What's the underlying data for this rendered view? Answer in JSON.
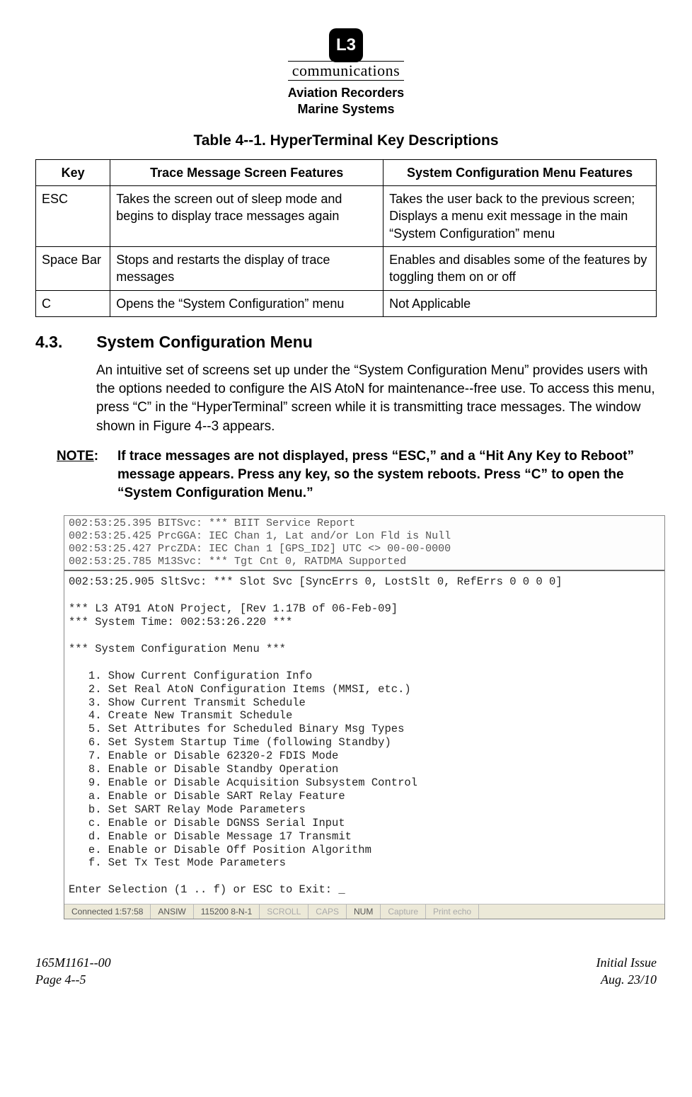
{
  "header": {
    "logo_text": "L3",
    "logo_sub": "communications",
    "line1": "Aviation Recorders",
    "line2": "Marine Systems"
  },
  "table_title": "Table 4--1.  HyperTerminal Key Descriptions",
  "table": {
    "headers": [
      "Key",
      "Trace Message Screen Features",
      "System Configuration Menu Features"
    ],
    "rows": [
      {
        "key": "ESC",
        "trace": "Takes the screen out of sleep mode and begins to display trace messages again",
        "sys": "Takes the user back to the previous screen; Displays a menu exit message in the main “System Configuration” menu"
      },
      {
        "key": "Space Bar",
        "trace": "Stops and restarts the display of trace messages",
        "sys": "Enables and disables some of the features by toggling them on or off"
      },
      {
        "key": "C",
        "trace": "Opens the “System Configuration” menu",
        "sys": "Not Applicable"
      }
    ]
  },
  "section": {
    "number": "4.3.",
    "title": "System Configuration Menu",
    "para": "An intuitive set of screens set up under the “System Configuration Menu” provides users with the options needed to configure the AIS AtoN for maintenance--free use. To access this menu, press “C” in the “HyperTerminal” screen while it is transmitting trace messages. The window shown in Figure 4--3 appears."
  },
  "note": {
    "label": "NOTE",
    "text": "If trace messages are not displayed, press “ESC,” and a “Hit Any Key to Reboot” message appears. Press any key, so the system reboots. Press “C” to open the “System Configuration Menu.”"
  },
  "terminal": {
    "top_lines": "002:53:25.395 BITSvc: *** BIIT Service Report\n002:53:25.425 PrcGGA: IEC Chan 1, Lat and/or Lon Fld is Null\n002:53:25.427 PrcZDA: IEC Chan 1 [GPS_ID2] UTC <> 00-00-0000\n002:53:25.785 M13Svc: *** Tgt Cnt 0, RATDMA Supported",
    "body_lines": "002:53:25.905 SltSvc: *** Slot Svc [SyncErrs 0, LostSlt 0, RefErrs 0 0 0 0]\n\n*** L3 AT91 AtoN Project, [Rev 1.17B of 06-Feb-09]\n*** System Time: 002:53:26.220 ***\n\n*** System Configuration Menu ***\n\n   1. Show Current Configuration Info\n   2. Set Real AtoN Configuration Items (MMSI, etc.)\n   3. Show Current Transmit Schedule\n   4. Create New Transmit Schedule\n   5. Set Attributes for Scheduled Binary Msg Types\n   6. Set System Startup Time (following Standby)\n   7. Enable or Disable 62320-2 FDIS Mode\n   8. Enable or Disable Standby Operation\n   9. Enable or Disable Acquisition Subsystem Control\n   a. Enable or Disable SART Relay Feature\n   b. Set SART Relay Mode Parameters\n   c. Enable or Disable DGNSS Serial Input\n   d. Enable or Disable Message 17 Transmit\n   e. Enable or Disable Off Position Algorithm\n   f. Set Tx Test Mode Parameters\n\nEnter Selection (1 .. f) or ESC to Exit: _",
    "status": {
      "connected": "Connected 1:57:58",
      "term_type": "ANSIW",
      "port": "115200 8-N-1",
      "scroll": "SCROLL",
      "caps": "CAPS",
      "num": "NUM",
      "capture": "Capture",
      "print": "Print echo"
    }
  },
  "footer": {
    "left1": "165M1161--00",
    "left2": "Page 4--5",
    "right1": "Initial Issue",
    "right2": "Aug. 23/10"
  }
}
